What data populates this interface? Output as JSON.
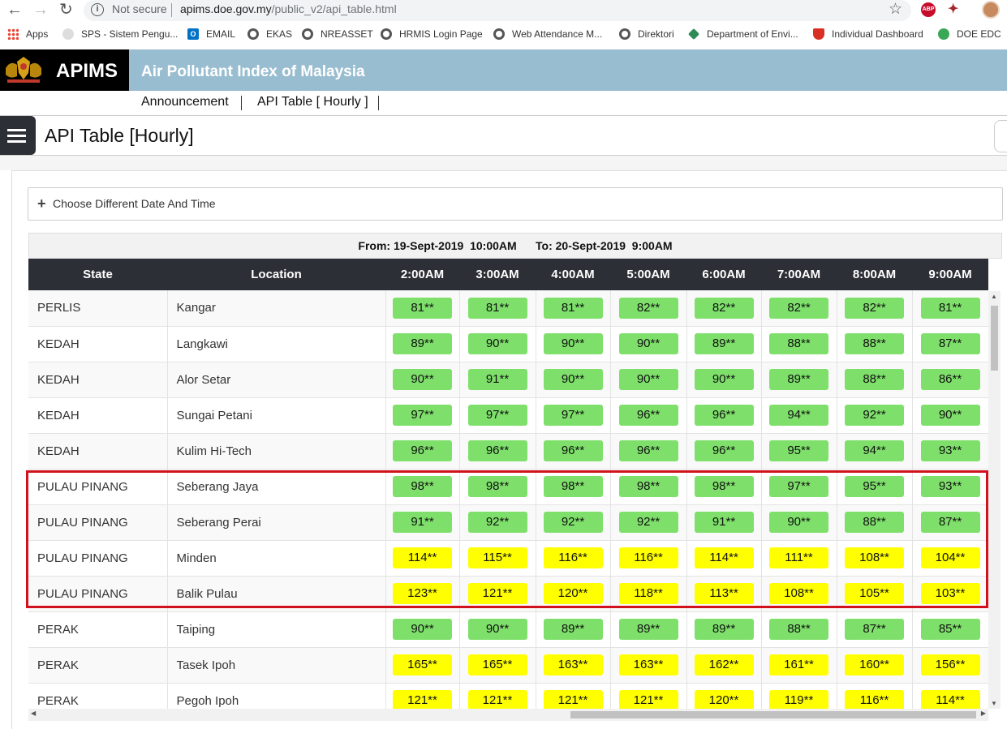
{
  "browser": {
    "security_label": "Not secure",
    "url_host": "apims.doe.gov.my",
    "url_path": "/public_v2/api_table.html",
    "bookmarks": [
      "Apps",
      "SPS - Sistem Pengu...",
      "EMAIL",
      "EKAS",
      "NREASSET",
      "HRMIS Login Page",
      "Web Attendance M...",
      "Direktori",
      "Department of Envi...",
      "Individual Dashboard",
      "DOE EDC"
    ]
  },
  "header": {
    "brand": "APIMS",
    "title": "Air Pollutant Index of Malaysia",
    "menu": [
      "Announcement",
      "API Table [ Hourly ]"
    ]
  },
  "page": {
    "title": "API Table [Hourly]",
    "date_toggle": "Choose Different Date And Time",
    "from_label": "From: 19-Sept-2019  10:00AM",
    "to_label": "To: 20-Sept-2019  9:00AM"
  },
  "table": {
    "headers": [
      "State",
      "Location",
      "2:00AM",
      "3:00AM",
      "4:00AM",
      "5:00AM",
      "6:00AM",
      "7:00AM",
      "8:00AM",
      "9:00AM"
    ],
    "rows": [
      {
        "state": "PERLIS",
        "location": "Kangar",
        "values": [
          "81**",
          "81**",
          "81**",
          "82**",
          "82**",
          "82**",
          "82**",
          "81**"
        ]
      },
      {
        "state": "KEDAH",
        "location": "Langkawi",
        "values": [
          "89**",
          "90**",
          "90**",
          "90**",
          "89**",
          "88**",
          "88**",
          "87**"
        ]
      },
      {
        "state": "KEDAH",
        "location": "Alor Setar",
        "values": [
          "90**",
          "91**",
          "90**",
          "90**",
          "90**",
          "89**",
          "88**",
          "86**"
        ]
      },
      {
        "state": "KEDAH",
        "location": "Sungai Petani",
        "values": [
          "97**",
          "97**",
          "97**",
          "96**",
          "96**",
          "94**",
          "92**",
          "90**"
        ]
      },
      {
        "state": "KEDAH",
        "location": "Kulim Hi-Tech",
        "values": [
          "96**",
          "96**",
          "96**",
          "96**",
          "96**",
          "95**",
          "94**",
          "93**"
        ]
      },
      {
        "state": "PULAU PINANG",
        "location": "Seberang Jaya",
        "values": [
          "98**",
          "98**",
          "98**",
          "98**",
          "98**",
          "97**",
          "95**",
          "93**"
        ]
      },
      {
        "state": "PULAU PINANG",
        "location": "Seberang Perai",
        "values": [
          "91**",
          "92**",
          "92**",
          "92**",
          "91**",
          "90**",
          "88**",
          "87**"
        ]
      },
      {
        "state": "PULAU PINANG",
        "location": "Minden",
        "values": [
          "114**",
          "115**",
          "116**",
          "116**",
          "114**",
          "111**",
          "108**",
          "104**"
        ]
      },
      {
        "state": "PULAU PINANG",
        "location": "Balik Pulau",
        "values": [
          "123**",
          "121**",
          "120**",
          "118**",
          "113**",
          "108**",
          "105**",
          "103**"
        ]
      },
      {
        "state": "PERAK",
        "location": "Taiping",
        "values": [
          "90**",
          "90**",
          "89**",
          "89**",
          "89**",
          "88**",
          "87**",
          "85**"
        ]
      },
      {
        "state": "PERAK",
        "location": "Tasek Ipoh",
        "values": [
          "165**",
          "165**",
          "163**",
          "163**",
          "162**",
          "161**",
          "160**",
          "156**"
        ]
      },
      {
        "state": "PERAK",
        "location": "Pegoh Ipoh",
        "values": [
          "121**",
          "121**",
          "121**",
          "121**",
          "120**",
          "119**",
          "116**",
          "114**"
        ]
      }
    ],
    "colors": {
      "good": "#7ee06b",
      "moderate": "#ffff00"
    }
  }
}
